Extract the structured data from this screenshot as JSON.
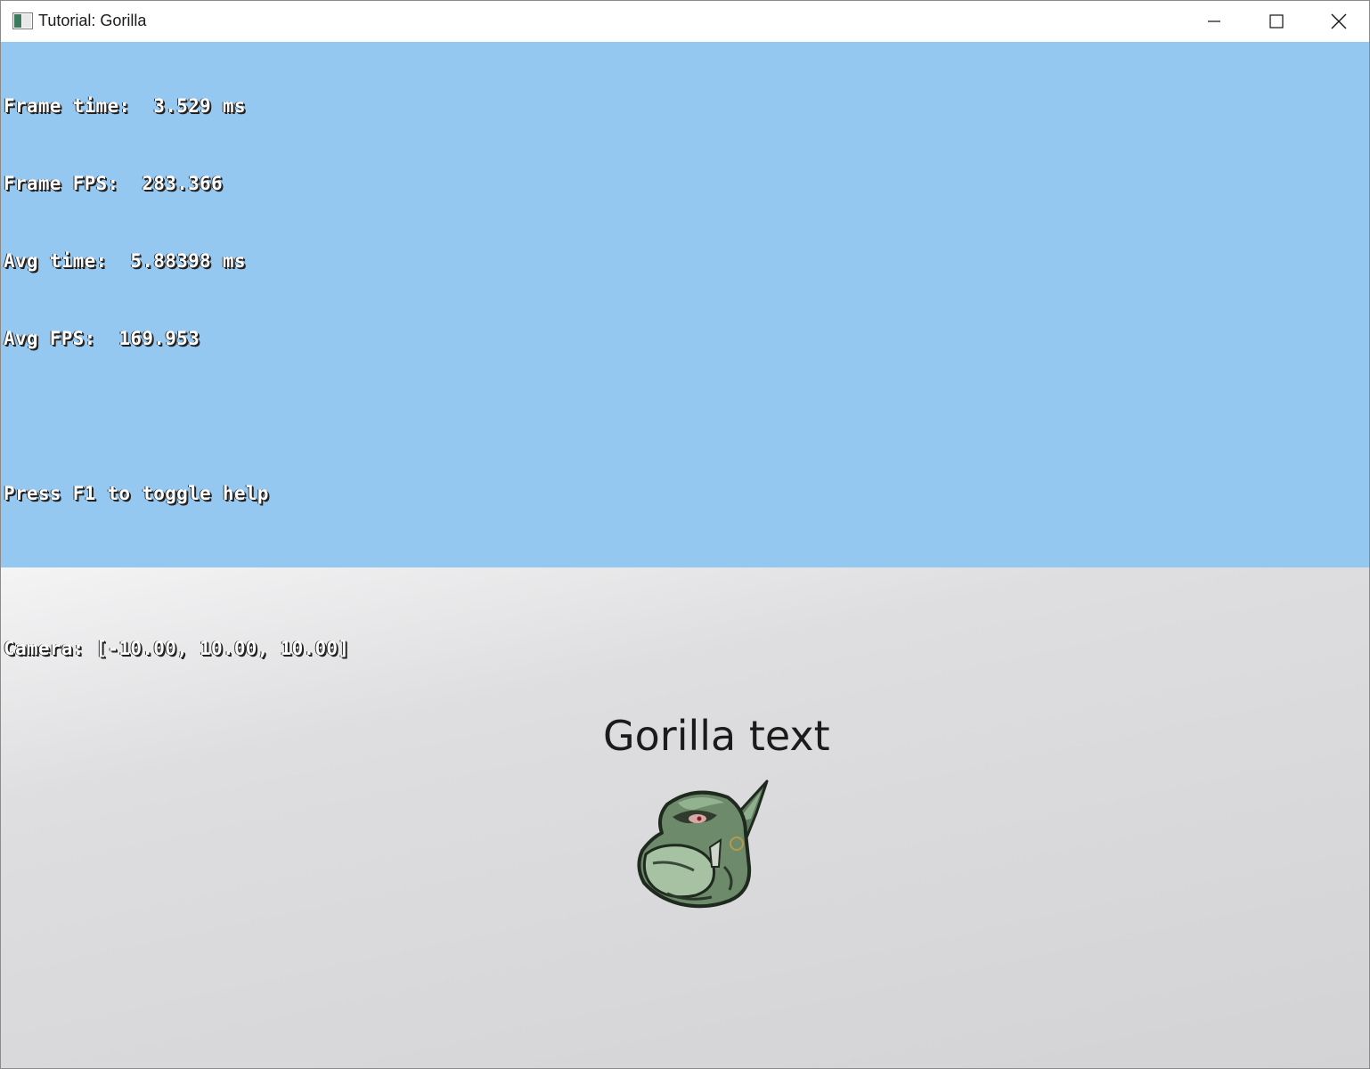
{
  "window": {
    "title": "Tutorial: Gorilla"
  },
  "hud": {
    "frame_time": "Frame time:  3.529 ms",
    "frame_fps": "Frame FPS:  283.366",
    "avg_time": "Avg time:  5.88398 ms",
    "avg_fps": "Avg FPS:  169.953",
    "help_hint": "Press F1 to toggle help",
    "camera": "Camera: [-10.00, 10.00, 10.00]"
  },
  "scene": {
    "gorilla_text": "Gorilla text",
    "sprite_icon": "goblin-head-icon"
  },
  "colors": {
    "sky": "#95c8f0",
    "ground": "#d8d8da",
    "hud_text": "#ffffff",
    "scene_text": "#1b1b1b"
  }
}
